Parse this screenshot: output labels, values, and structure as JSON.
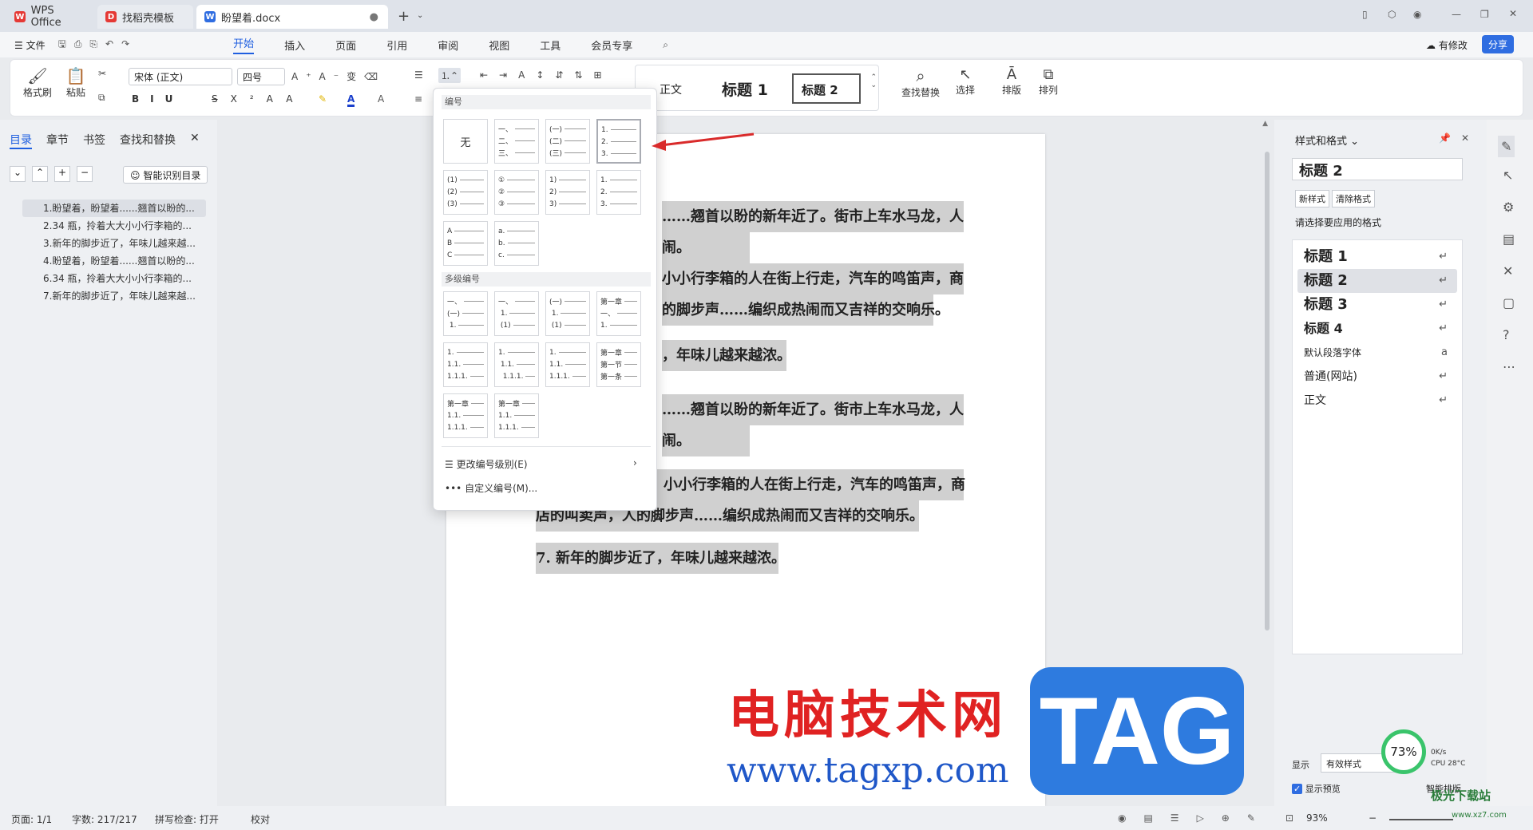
{
  "tabs": [
    {
      "label": "WPS Office"
    },
    {
      "label": "找稻壳模板"
    },
    {
      "label": "盼望着.docx"
    }
  ],
  "menu": {
    "file": "文件",
    "items": [
      "开始",
      "插入",
      "页面",
      "引用",
      "审阅",
      "视图",
      "工具",
      "会员专享"
    ],
    "has_changes": "有修改",
    "share": "分享"
  },
  "ribbon": {
    "format_painter": "格式刷",
    "paste": "粘贴",
    "font": "宋体 (正文)",
    "size": "四号",
    "style_normal": "正文",
    "style_h1": "标题 1",
    "style_h2": "标题 2",
    "find_replace": "查找替换",
    "select": "选择",
    "layout": "排版",
    "arrange": "排列"
  },
  "left_panel": {
    "tabs": [
      "目录",
      "章节",
      "书签",
      "查找和替换"
    ],
    "smart_btn": "智能识别目录",
    "outline": [
      "1.盼望着，盼望着......翘首以盼的...",
      "2.34 瓶，拎着大大小小行李箱的...",
      "3.新年的脚步近了，年味儿越来越...",
      "4.盼望着，盼望着......翘首以盼的...",
      "6.34 瓶，拎着大大小小行李箱的...",
      "7.新年的脚步近了，年味儿越来越..."
    ]
  },
  "numbering_dropdown": {
    "section1": "编号",
    "none": "无",
    "section2": "多级编号",
    "change_level": "更改编号级别(E)",
    "custom": "自定义编号(M)..."
  },
  "document": {
    "lines": [
      "……翘首以盼的新年近了。街市上车水马龙，人",
      "闹。",
      "小小行李箱的人在街上行走，汽车的鸣笛声，商",
      "的脚步声……编织成热闹而又吉祥的交响乐。",
      "，年味儿越来越浓。",
      "……翘首以盼的新年近了。街市上车水马龙，人",
      "闹。",
      "小小行李箱的人在街上行走，汽车的鸣笛声，商",
      "店的叫卖声，人的脚步声……编织成热闹而又吉祥的交响乐。",
      "7. 新年的脚步近了，年味儿越来越浓。"
    ]
  },
  "right_panel": {
    "title": "样式和格式",
    "current": "标题 2",
    "new_style": "新样式",
    "clear_format": "清除格式",
    "prompt": "请选择要应用的格式",
    "styles": [
      "标题 1",
      "标题 2",
      "标题 3",
      "标题 4",
      "默认段落字体",
      "普通(网站)",
      "正文"
    ],
    "show_label": "显示",
    "show_value": "有效样式",
    "preview": "显示预览",
    "smart_layout": "智能排版"
  },
  "status": {
    "page": "页面: 1/1",
    "words": "字数: 217/217",
    "spell": "拼写检查: 打开",
    "proof": "校对",
    "zoom": "93%"
  },
  "perf": {
    "percent": "73%",
    "net": "0K/s",
    "cpu": "CPU 28°C"
  },
  "watermark": {
    "cn": "电脑技术网",
    "url": "www.tagxp.com",
    "logo": "TAG",
    "site": "极光下载站",
    "site_url": "www.xz7.com"
  }
}
